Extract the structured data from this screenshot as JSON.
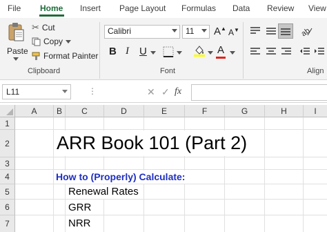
{
  "ribbon_tabs": [
    "File",
    "Home",
    "Insert",
    "Page Layout",
    "Formulas",
    "Data",
    "Review",
    "View"
  ],
  "clipboard": {
    "paste_label": "Paste",
    "cut_label": "Cut",
    "copy_label": "Copy",
    "format_painter_label": "Format Painter",
    "group_label": "Clipboard"
  },
  "font": {
    "name": "Calibri",
    "size": "11",
    "group_label": "Font",
    "bold": "B",
    "italic": "I",
    "underline": "U",
    "grow": "A",
    "shrink": "A",
    "font_color_letter": "A"
  },
  "alignment": {
    "group_label": "Align"
  },
  "formula_bar": {
    "cell_ref": "L11",
    "cancel_symbol": "✕",
    "enter_symbol": "✓",
    "fx_label": "fx",
    "formula_value": ""
  },
  "columns": [
    "A",
    "B",
    "C",
    "D",
    "E",
    "F",
    "G",
    "H",
    "I"
  ],
  "rows": [
    "1",
    "2",
    "3",
    "4",
    "5",
    "6",
    "7"
  ],
  "cells": {
    "title": "ARR Book 101 (Part 2)",
    "subtitle": "How to (Properly) Calculate:",
    "item1": "Renewal Rates",
    "item2": "GRR",
    "item3": "NRR"
  },
  "colors": {
    "accent": "#1e6c3a",
    "subtitle": "#1f2fbf",
    "font_color_bar": "#e0231d",
    "highlight_bar": "#ffff00"
  }
}
